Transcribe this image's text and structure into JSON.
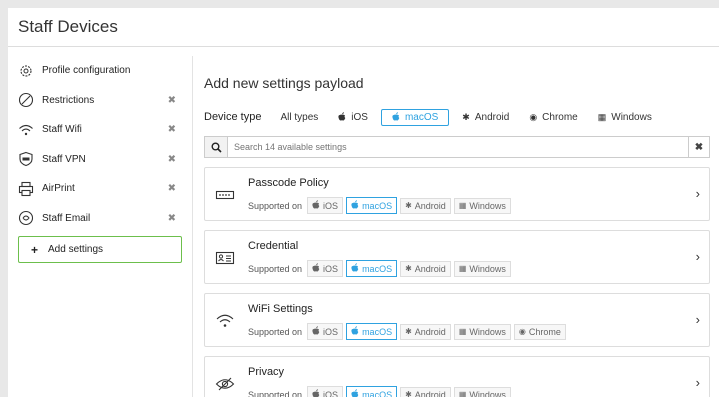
{
  "page": {
    "title": "Staff Devices"
  },
  "sidebar": {
    "items": [
      {
        "label": "Profile configuration",
        "icon": "gear-icon",
        "removable": false
      },
      {
        "label": "Restrictions",
        "icon": "restrictions-icon",
        "removable": true
      },
      {
        "label": "Staff Wifi",
        "icon": "wifi-icon",
        "removable": true
      },
      {
        "label": "Staff VPN",
        "icon": "vpn-shield-icon",
        "removable": true
      },
      {
        "label": "AirPrint",
        "icon": "printer-icon",
        "removable": true
      },
      {
        "label": "Staff Email",
        "icon": "email-icon",
        "removable": true
      }
    ],
    "remove_glyph": "✖",
    "add_label": "Add settings"
  },
  "main": {
    "heading": "Add new settings payload",
    "device_type_label": "Device type",
    "device_tabs": [
      {
        "label": "All types",
        "icon": "",
        "active": false
      },
      {
        "label": "iOS",
        "icon": "apple-icon",
        "active": false
      },
      {
        "label": "macOS",
        "icon": "apple-icon",
        "active": true
      },
      {
        "label": "Android",
        "icon": "android-icon",
        "active": false
      },
      {
        "label": "Chrome",
        "icon": "chrome-icon",
        "active": false
      },
      {
        "label": "Windows",
        "icon": "windows-icon",
        "active": false
      }
    ],
    "search_placeholder": "Search 14 available settings",
    "supported_label": "Supported on",
    "settings": [
      {
        "title": "Passcode Policy",
        "icon": "passcode-icon",
        "platforms": [
          "iOS",
          "macOS",
          "Android",
          "Windows"
        ]
      },
      {
        "title": "Credential",
        "icon": "credential-icon",
        "platforms": [
          "iOS",
          "macOS",
          "Android",
          "Windows"
        ]
      },
      {
        "title": "WiFi Settings",
        "icon": "wifi-icon",
        "platforms": [
          "iOS",
          "macOS",
          "Android",
          "Windows",
          "Chrome"
        ]
      },
      {
        "title": "Privacy",
        "icon": "privacy-eye-icon",
        "platforms": [
          "iOS",
          "macOS",
          "Android",
          "Windows"
        ]
      }
    ],
    "highlight_platform": "macOS"
  },
  "colors": {
    "accent_blue": "#2fa2e0",
    "accent_green": "#6cbf4c"
  }
}
